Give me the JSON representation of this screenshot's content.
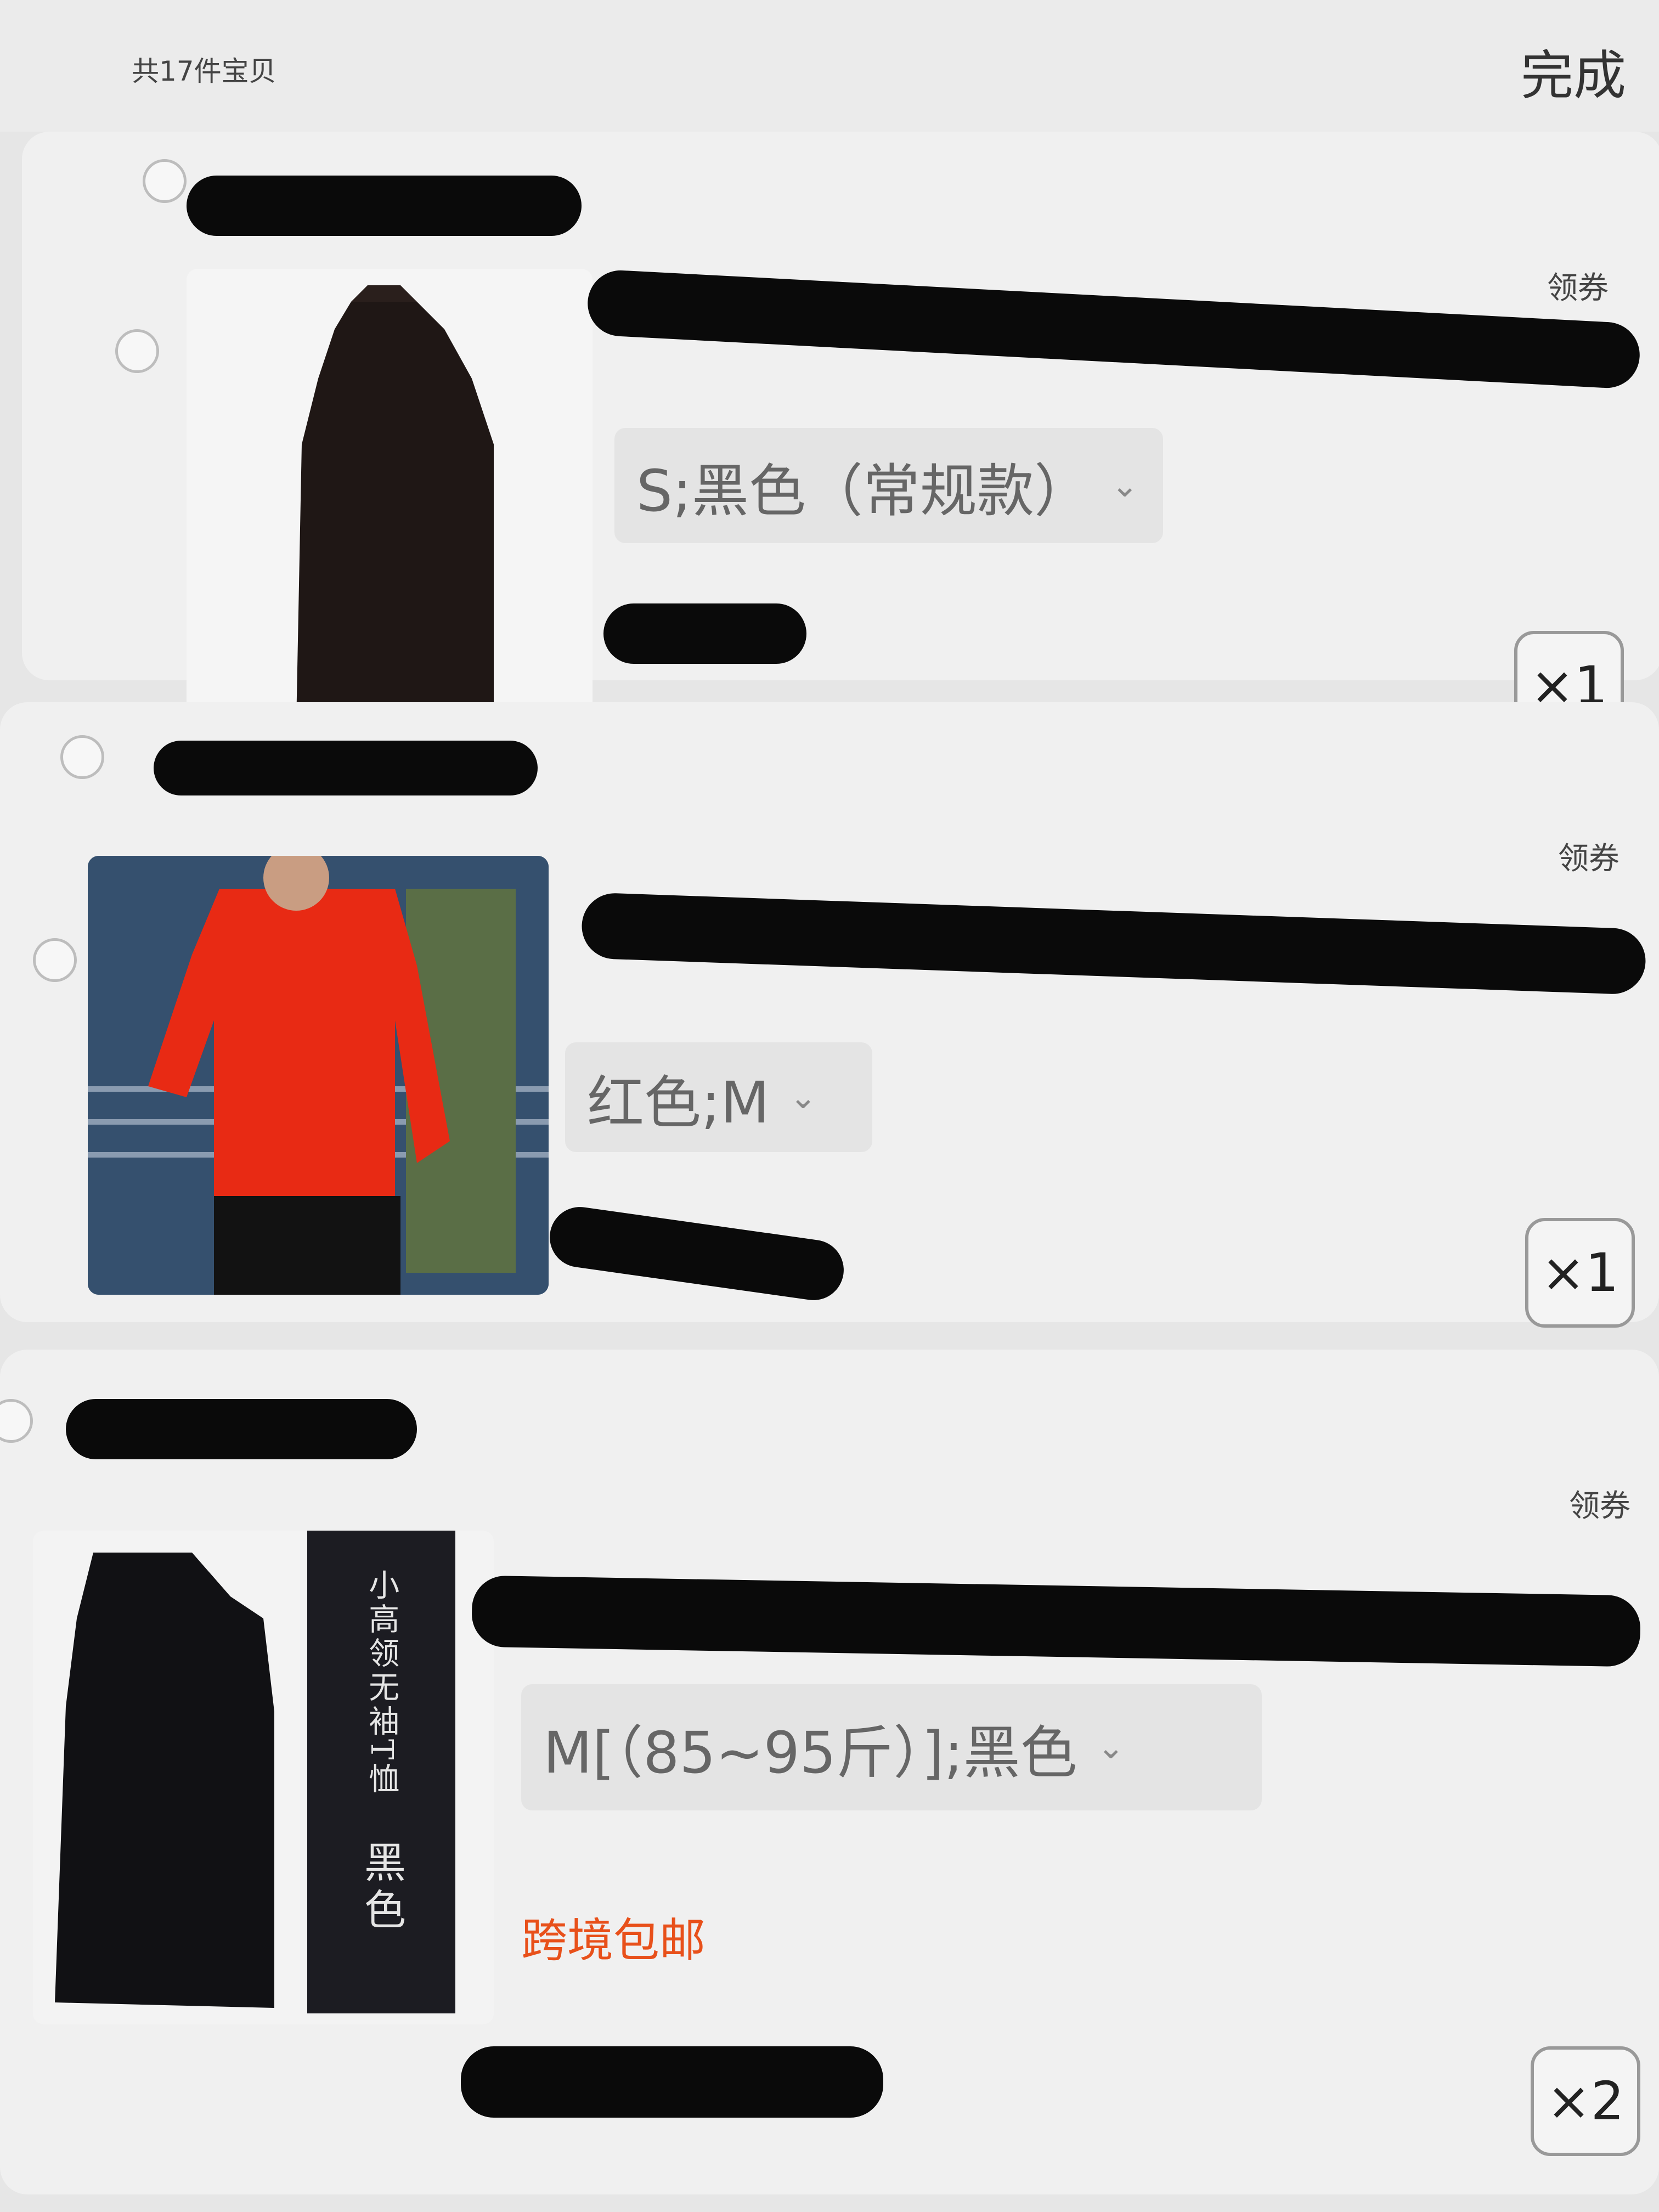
{
  "header": {
    "count_text": "共17件宝贝",
    "done_label": "完成"
  },
  "items": [
    {
      "coupon": "领券",
      "sku": "S;黑色（常规款）",
      "quantity": "×1",
      "image": "black-sleeveless-top"
    },
    {
      "coupon": "领券",
      "sku": "红色;M",
      "quantity": "×1",
      "image": "red-hoodie-model"
    },
    {
      "coupon": "领券",
      "sku": "M[（85~95斤）];黑色",
      "quantity": "×2",
      "shipping": "跨境包邮",
      "image": "black-sleeveless-top",
      "image_label": {
        "title": "小高领无袖T恤",
        "color": "黑色"
      }
    }
  ],
  "icons": {
    "chevron": "chevron-down-icon"
  },
  "colors": {
    "shipping_tag": "#e8501a",
    "redaction": "#0a0a0a"
  }
}
